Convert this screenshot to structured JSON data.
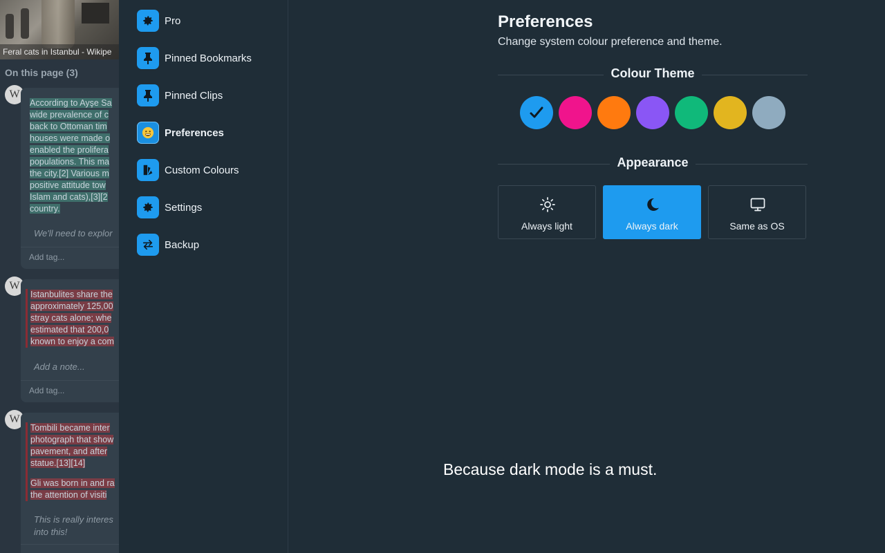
{
  "background_page": {
    "image_caption": "Feral cats in Istanbul - Wikipe",
    "section_title": "On this page (3)",
    "clips": [
      {
        "source_icon": "W",
        "lines": [
          "According to Ayşe Sa",
          "wide prevalence of c",
          "back to Ottoman tim",
          "houses were made o",
          "enabled the prolifera",
          "populations. This ma",
          "the city.[2] Various m",
          "positive attitude tow",
          "Islam and cats),[3][2",
          "country."
        ],
        "highlight": "green",
        "note": "We'll need to explor",
        "tag_placeholder": "Add tag..."
      },
      {
        "source_icon": "W",
        "lines": [
          "Istanbulites share the",
          "approximately 125,00",
          "stray cats alone; whe",
          "estimated that 200,0",
          "known to enjoy a com"
        ],
        "highlight": "red",
        "note": "Add a note...",
        "tag_placeholder": "Add tag..."
      },
      {
        "source_icon": "W",
        "lines": [
          "Tombili became inter",
          "photograph that show",
          "pavement, and after",
          "statue.[13][14]"
        ],
        "lines2": [
          "Gli was born in and ra",
          "the attention of visiti"
        ],
        "highlight": "red",
        "note": "This is really interes",
        "note2": "into this!"
      }
    ]
  },
  "sidebar": {
    "items": [
      {
        "label": "Pro",
        "icon": "gear-icon",
        "active": false
      },
      {
        "label": "Pinned Bookmarks",
        "icon": "pin-icon",
        "active": false
      },
      {
        "label": "Pinned Clips",
        "icon": "pin-icon",
        "active": false
      },
      {
        "label": "Preferences",
        "icon": "smiley-icon",
        "active": true
      },
      {
        "label": "Custom Colours",
        "icon": "palette-icon",
        "active": false
      },
      {
        "label": "Settings",
        "icon": "gear-icon",
        "active": false
      },
      {
        "label": "Backup",
        "icon": "swap-arrows-icon",
        "active": false
      }
    ]
  },
  "main": {
    "title": "Preferences",
    "subtitle": "Change system colour preference and theme.",
    "colour_theme": {
      "heading": "Colour Theme",
      "selected": 0,
      "swatches": [
        "#1e9bef",
        "#f0148c",
        "#ff7a0f",
        "#8a56f5",
        "#10b97a",
        "#e2b51f",
        "#8fabbf"
      ]
    },
    "appearance": {
      "heading": "Appearance",
      "options": [
        {
          "label": "Always light",
          "icon": "sun-icon",
          "active": false
        },
        {
          "label": "Always dark",
          "icon": "moon-icon",
          "active": true
        },
        {
          "label": "Same as OS",
          "icon": "monitor-icon",
          "active": false
        }
      ]
    },
    "tagline": "Because dark mode is a must."
  },
  "colors": {
    "accent": "#1e9bef",
    "background": "#1f2d37"
  }
}
